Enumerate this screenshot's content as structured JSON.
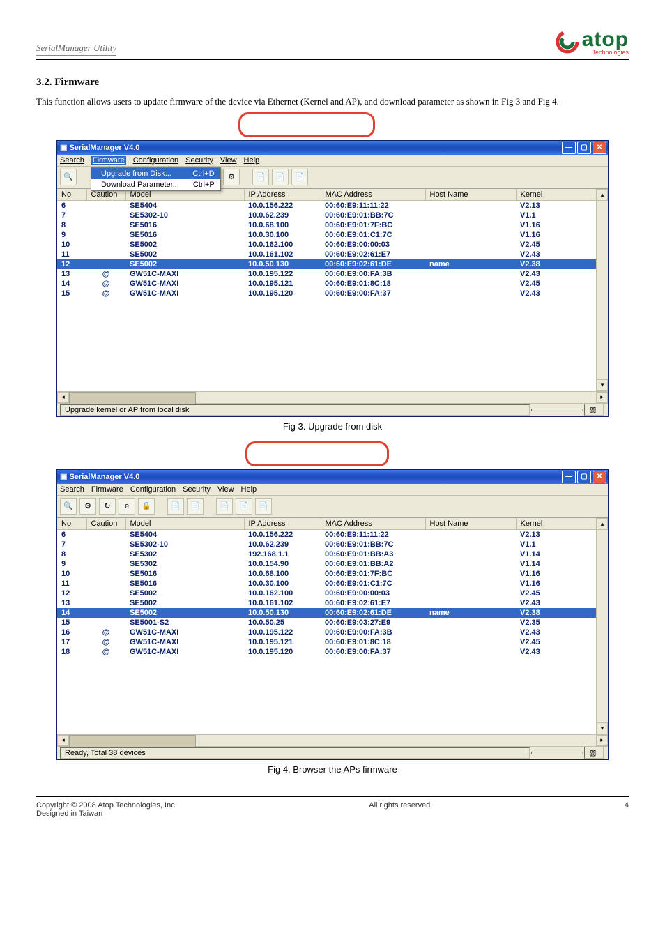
{
  "header_left": "SerialManager Utility",
  "logo_text": "atop",
  "logo_sub": "Technologies",
  "section_title": "3.2.  Firmware",
  "body1": "This function allows users to update firmware of the device via Ethernet (Kernel and AP), and download parameter as shown in Fig 3 and Fig 4.",
  "caption1": "Fig 3. Upgrade from disk",
  "caption2": "Fig 4. Browser the APs firmware",
  "win1": {
    "title": "SerialManager V4.0",
    "menu": [
      "Search",
      "Firmware",
      "Configuration",
      "Security",
      "View",
      "Help"
    ],
    "open_menu": "Firmware",
    "menu_items": [
      {
        "label": "Upgrade from Disk...",
        "accel": "Ctrl+D",
        "hilite": true
      },
      {
        "label": "Download Parameter...",
        "accel": "Ctrl+P"
      }
    ],
    "columns": [
      "No.",
      "Caution",
      "Model",
      "IP Address",
      "MAC Address",
      "Host Name",
      "Kernel"
    ],
    "rows": [
      {
        "no": "6",
        "caution": "",
        "model": "SE5404",
        "ip": "10.0.156.222",
        "mac": "00:60:E9:11:11:22",
        "host": "",
        "kernel": "V2.13"
      },
      {
        "no": "7",
        "caution": "",
        "model": "SE5302-10",
        "ip": "10.0.62.239",
        "mac": "00:60:E9:01:BB:7C",
        "host": "",
        "kernel": "V1.1"
      },
      {
        "no": "8",
        "caution": "",
        "model": "SE5016",
        "ip": "10.0.68.100",
        "mac": "00:60:E9:01:7F:BC",
        "host": "",
        "kernel": "V1.16"
      },
      {
        "no": "9",
        "caution": "",
        "model": "SE5016",
        "ip": "10.0.30.100",
        "mac": "00:60:E9:01:C1:7C",
        "host": "",
        "kernel": "V1.16"
      },
      {
        "no": "10",
        "caution": "",
        "model": "SE5002",
        "ip": "10.0.162.100",
        "mac": "00:60:E9:00:00:03",
        "host": "",
        "kernel": "V2.45"
      },
      {
        "no": "11",
        "caution": "",
        "model": "SE5002",
        "ip": "10.0.161.102",
        "mac": "00:60:E9:02:61:E7",
        "host": "",
        "kernel": "V2.43"
      },
      {
        "no": "12",
        "caution": "",
        "model": "SE5002",
        "ip": "10.0.50.130",
        "mac": "00:60:E9:02:61:DE",
        "host": "name",
        "kernel": "V2.38",
        "selected": true
      },
      {
        "no": "13",
        "caution": "@",
        "model": "GW51C-MAXI",
        "ip": "10.0.195.122",
        "mac": "00:60:E9:00:FA:3B",
        "host": "",
        "kernel": "V2.43"
      },
      {
        "no": "14",
        "caution": "@",
        "model": "GW51C-MAXI",
        "ip": "10.0.195.121",
        "mac": "00:60:E9:01:8C:18",
        "host": "",
        "kernel": "V2.45"
      },
      {
        "no": "15",
        "caution": "@",
        "model": "GW51C-MAXI",
        "ip": "10.0.195.120",
        "mac": "00:60:E9:00:FA:37",
        "host": "",
        "kernel": "V2.43"
      }
    ],
    "status": "Upgrade kernel or AP from local disk"
  },
  "win2": {
    "title": "SerialManager V4.0",
    "menu": [
      "Search",
      "Firmware",
      "Configuration",
      "Security",
      "View",
      "Help"
    ],
    "columns": [
      "No.",
      "Caution",
      "Model",
      "IP Address",
      "MAC Address",
      "Host Name",
      "Kernel"
    ],
    "rows": [
      {
        "no": "6",
        "caution": "",
        "model": "SE5404",
        "ip": "10.0.156.222",
        "mac": "00:60:E9:11:11:22",
        "host": "",
        "kernel": "V2.13"
      },
      {
        "no": "7",
        "caution": "",
        "model": "SE5302-10",
        "ip": "10.0.62.239",
        "mac": "00:60:E9:01:BB:7C",
        "host": "",
        "kernel": "V1.1"
      },
      {
        "no": "8",
        "caution": "",
        "model": "SE5302",
        "ip": "192.168.1.1",
        "mac": "00:60:E9:01:BB:A3",
        "host": "",
        "kernel": "V1.14"
      },
      {
        "no": "9",
        "caution": "",
        "model": "SE5302",
        "ip": "10.0.154.90",
        "mac": "00:60:E9:01:BB:A2",
        "host": "",
        "kernel": "V1.14"
      },
      {
        "no": "10",
        "caution": "",
        "model": "SE5016",
        "ip": "10.0.68.100",
        "mac": "00:60:E9:01:7F:BC",
        "host": "",
        "kernel": "V1.16"
      },
      {
        "no": "11",
        "caution": "",
        "model": "SE5016",
        "ip": "10.0.30.100",
        "mac": "00:60:E9:01:C1:7C",
        "host": "",
        "kernel": "V1.16"
      },
      {
        "no": "12",
        "caution": "",
        "model": "SE5002",
        "ip": "10.0.162.100",
        "mac": "00:60:E9:00:00:03",
        "host": "",
        "kernel": "V2.45"
      },
      {
        "no": "13",
        "caution": "",
        "model": "SE5002",
        "ip": "10.0.161.102",
        "mac": "00:60:E9:02:61:E7",
        "host": "",
        "kernel": "V2.43"
      },
      {
        "no": "14",
        "caution": "",
        "model": "SE5002",
        "ip": "10.0.50.130",
        "mac": "00:60:E9:02:61:DE",
        "host": "name",
        "kernel": "V2.38",
        "selected": true
      },
      {
        "no": "15",
        "caution": "",
        "model": "SE5001-S2",
        "ip": "10.0.50.25",
        "mac": "00:60:E9:03:27:E9",
        "host": "",
        "kernel": "V2.35"
      },
      {
        "no": "16",
        "caution": "@",
        "model": "GW51C-MAXI",
        "ip": "10.0.195.122",
        "mac": "00:60:E9:00:FA:3B",
        "host": "",
        "kernel": "V2.43"
      },
      {
        "no": "17",
        "caution": "@",
        "model": "GW51C-MAXI",
        "ip": "10.0.195.121",
        "mac": "00:60:E9:01:8C:18",
        "host": "",
        "kernel": "V2.45"
      },
      {
        "no": "18",
        "caution": "@",
        "model": "GW51C-MAXI",
        "ip": "10.0.195.120",
        "mac": "00:60:E9:00:FA:37",
        "host": "",
        "kernel": "V2.43"
      }
    ],
    "status": "Ready, Total 38 devices"
  },
  "footer_left": "Copyright © 2008 Atop Technologies, Inc.",
  "footer_center": "All rights reserved.",
  "footer_right": "4",
  "footer_sub": "Designed in Taiwan"
}
